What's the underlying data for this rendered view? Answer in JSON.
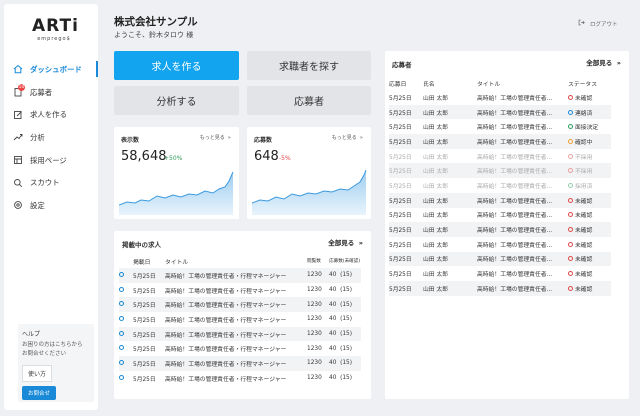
{
  "brand": {
    "name": "ARTi",
    "sub": "emprego$"
  },
  "sidebar": {
    "items": [
      {
        "label": "ダッシュボード",
        "icon": "home-icon",
        "active": true
      },
      {
        "label": "応募者",
        "icon": "document-icon",
        "badge": "10"
      },
      {
        "label": "求人を作る",
        "icon": "edit-icon"
      },
      {
        "label": "分析",
        "icon": "trend-icon"
      },
      {
        "label": "採用ページ",
        "icon": "layout-icon"
      },
      {
        "label": "スカウト",
        "icon": "search-icon"
      },
      {
        "label": "設定",
        "icon": "gear-icon"
      }
    ],
    "help": {
      "title": "ヘルプ",
      "desc": "お困りの方はこちらから\nお問合せください",
      "guide": "使い方",
      "contact": "お問合せ"
    }
  },
  "header": {
    "company": "株式会社サンプル",
    "welcome": "ようこそ、鈴木タロウ 様",
    "logout": "ログアウト"
  },
  "actions": {
    "create_job": "求人を作る",
    "find_candidates": "求職者を探す",
    "analyze": "分析する",
    "applicants": "応募者"
  },
  "stats": [
    {
      "label": "表示数",
      "value": "58,648",
      "delta": "+50%",
      "delta_color": "#2e9e5b",
      "more": "もっと見る"
    },
    {
      "label": "応募数",
      "value": "648",
      "delta": "-5%",
      "delta_color": "#e04848",
      "more": "もっと見る"
    }
  ],
  "jobs": {
    "title": "掲載中の求人",
    "see_all": "全部見る",
    "headers": [
      "掲載日",
      "タイトル",
      "閲覧数",
      "応募数(未確認)"
    ],
    "rows": [
      {
        "date": "5月25日",
        "title": "高時給！工場の管理責任者・行程マネージャー",
        "views": "1230",
        "apps": "40",
        "unread": "(15)"
      },
      {
        "date": "5月25日",
        "title": "高時給！工場の管理責任者・行程マネージャー",
        "views": "1230",
        "apps": "40",
        "unread": "(15)"
      },
      {
        "date": "5月25日",
        "title": "高時給！工場の管理責任者・行程マネージャー",
        "views": "1230",
        "apps": "40",
        "unread": "(15)"
      },
      {
        "date": "5月25日",
        "title": "高時給！工場の管理責任者・行程マネージャー",
        "views": "1230",
        "apps": "40",
        "unread": "(15)"
      },
      {
        "date": "5月25日",
        "title": "高時給！工場の管理責任者・行程マネージャー",
        "views": "1230",
        "apps": "40",
        "unread": "(15)"
      },
      {
        "date": "5月25日",
        "title": "高時給！工場の管理責任者・行程マネージャー",
        "views": "1230",
        "apps": "40",
        "unread": "(15)"
      },
      {
        "date": "5月25日",
        "title": "高時給！工場の管理責任者・行程マネージャー",
        "views": "1230",
        "apps": "40",
        "unread": "(15)"
      },
      {
        "date": "5月25日",
        "title": "高時給！工場の管理責任者・行程マネージャー",
        "views": "1230",
        "apps": "40",
        "unread": "(15)"
      }
    ]
  },
  "applicants": {
    "title": "応募者",
    "see_all": "全部見る",
    "headers": [
      "応募日",
      "氏名",
      "タイトル",
      "ステータス"
    ],
    "rows": [
      {
        "date": "5月25日",
        "name": "山田 太郎",
        "title": "高時給！工場の管理責任者...",
        "status": "未確認",
        "color": "#e04848",
        "faded": false
      },
      {
        "date": "5月25日",
        "name": "山田 太郎",
        "title": "高時給！工場の管理責任者...",
        "status": "連絡済",
        "color": "#1a8ad8",
        "faded": false
      },
      {
        "date": "5月25日",
        "name": "山田 太郎",
        "title": "高時給！工場の管理責任者...",
        "status": "面接決定",
        "color": "#2e9e5b",
        "faded": false
      },
      {
        "date": "5月25日",
        "name": "山田 太郎",
        "title": "高時給！工場の管理責任者...",
        "status": "確認中",
        "color": "#f0a030",
        "faded": false
      },
      {
        "date": "5月25日",
        "name": "山田 太郎",
        "title": "高時給！工場の管理責任者...",
        "status": "不採用",
        "color": "#e04848",
        "faded": true
      },
      {
        "date": "5月25日",
        "name": "山田 太郎",
        "title": "高時給！工場の管理責任者...",
        "status": "不採用",
        "color": "#e04848",
        "faded": true
      },
      {
        "date": "5月25日",
        "name": "山田 太郎",
        "title": "高時給！工場の管理責任者...",
        "status": "採用済",
        "color": "#2e9e5b",
        "faded": true
      },
      {
        "date": "5月25日",
        "name": "山田 太郎",
        "title": "高時給！工場の管理責任者...",
        "status": "未確認",
        "color": "#e04848",
        "faded": false
      },
      {
        "date": "5月25日",
        "name": "山田 太郎",
        "title": "高時給！工場の管理責任者...",
        "status": "未確認",
        "color": "#e04848",
        "faded": false
      },
      {
        "date": "5月25日",
        "name": "山田 太郎",
        "title": "高時給！工場の管理責任者...",
        "status": "未確認",
        "color": "#e04848",
        "faded": false
      },
      {
        "date": "5月25日",
        "name": "山田 太郎",
        "title": "高時給！工場の管理責任者...",
        "status": "未確認",
        "color": "#e04848",
        "faded": false
      },
      {
        "date": "5月25日",
        "name": "山田 太郎",
        "title": "高時給！工場の管理責任者...",
        "status": "未確認",
        "color": "#e04848",
        "faded": false
      },
      {
        "date": "5月25日",
        "name": "山田 太郎",
        "title": "高時給！工場の管理責任者...",
        "status": "未確認",
        "color": "#e04848",
        "faded": false
      },
      {
        "date": "5月25日",
        "name": "山田 太郎",
        "title": "高時給！工場の管理責任者...",
        "status": "未確認",
        "color": "#e04848",
        "faded": false
      }
    ]
  }
}
